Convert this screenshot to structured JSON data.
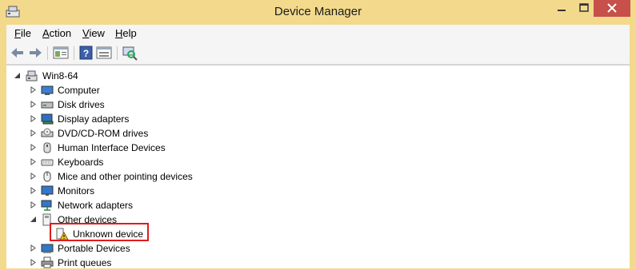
{
  "window": {
    "title": "Device Manager",
    "accent": "#f3d98c"
  },
  "menu": [
    {
      "label_acc": "F",
      "label_rest": "ile"
    },
    {
      "label_acc": "A",
      "label_rest": "ction"
    },
    {
      "label_acc": "V",
      "label_rest": "iew"
    },
    {
      "label_acc": "H",
      "label_rest": "elp"
    }
  ],
  "toolbar": {
    "buttons": [
      "back-icon",
      "forward-icon",
      "properties-icon",
      "help-icon",
      "update-driver-icon",
      "scan-hardware-icon"
    ]
  },
  "tree": {
    "root": "Win8-64",
    "items": [
      {
        "label": "Computer",
        "icon": "computer-icon"
      },
      {
        "label": "Disk drives",
        "icon": "disk-drive-icon"
      },
      {
        "label": "Display adapters",
        "icon": "display-adapter-icon"
      },
      {
        "label": "DVD/CD-ROM drives",
        "icon": "dvd-drive-icon"
      },
      {
        "label": "Human Interface Devices",
        "icon": "hid-icon"
      },
      {
        "label": "Keyboards",
        "icon": "keyboard-icon"
      },
      {
        "label": "Mice and other pointing devices",
        "icon": "mouse-icon"
      },
      {
        "label": "Monitors",
        "icon": "monitor-icon"
      },
      {
        "label": "Network adapters",
        "icon": "network-adapter-icon"
      },
      {
        "label": "Other devices",
        "icon": "other-devices-icon",
        "expanded": true
      },
      {
        "label": "Unknown device",
        "icon": "unknown-device-warning-icon",
        "child": true
      },
      {
        "label": "Portable Devices",
        "icon": "portable-devices-icon"
      },
      {
        "label": "Print queues",
        "icon": "printer-icon"
      }
    ]
  },
  "highlight_color": "#e01b1b"
}
